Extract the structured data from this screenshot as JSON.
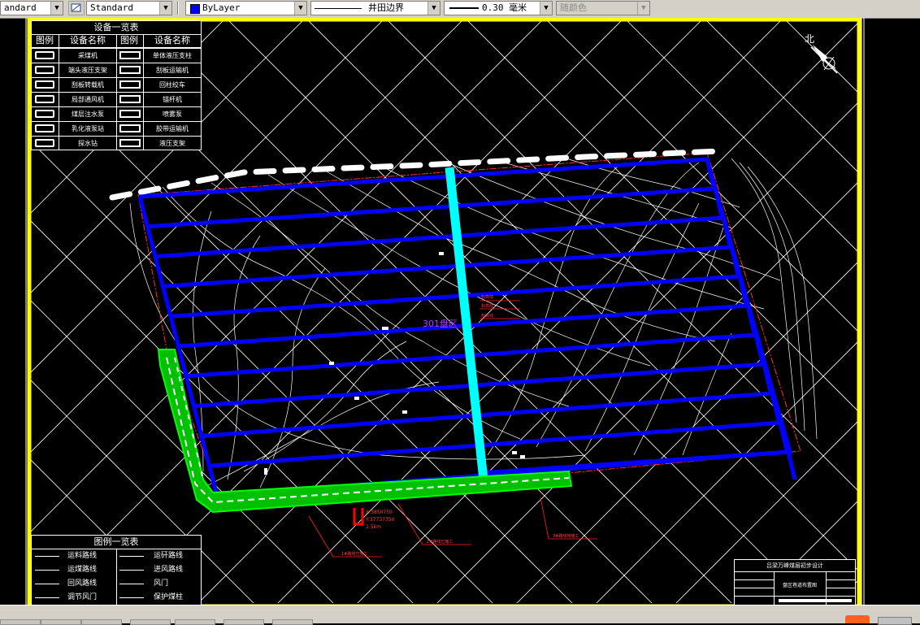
{
  "toolbar": {
    "text_style_value": "andard",
    "dim_style_value": "Standard",
    "layer_color_value": "ByLayer",
    "linetype_value": "井田边界",
    "lineweight_value": "0.30 毫米",
    "plot_style_value": "随颜色",
    "arrow_glyph": "▼"
  },
  "equipment_table": {
    "title": "设备一览表",
    "headers": [
      "图例",
      "设备名称",
      "图例",
      "设备名称"
    ],
    "rows": [
      {
        "left": "采煤机",
        "right": "单体液压支柱"
      },
      {
        "left": "端头液压支架",
        "right": "刮板运输机"
      },
      {
        "left": "刮板转载机",
        "right": "回柱绞车"
      },
      {
        "left": "局部通风机",
        "right": "锚杆机"
      },
      {
        "left": "煤层注水泵",
        "right": "喷雾泵"
      },
      {
        "left": "乳化液泵站",
        "right": "胶带运输机"
      },
      {
        "left": "探水钻",
        "right": "液压支架"
      }
    ]
  },
  "legend_table": {
    "title": "图例一览表",
    "rows": [
      {
        "left": "运料路线",
        "right": "运矸路线"
      },
      {
        "left": "运煤路线",
        "right": "进风路线"
      },
      {
        "left": "回风路线",
        "right": "风门"
      },
      {
        "left": "调节风门",
        "right": "保护煤柱"
      }
    ]
  },
  "drawing": {
    "north_label": "北",
    "district_label": "301盘区",
    "coord_label_1": "X:3850750",
    "coord_label_2": "Y:37737350",
    "coord_label_3": "1:5km"
  },
  "title_block": {
    "title": "吕梁万峰煤层初步设计",
    "subtitle": "盘区巷道布置图"
  },
  "colors": {
    "frame": "#ffff00",
    "roadway": "#0000ff",
    "main_roadway": "#00ffff",
    "pillar": "#00ff00",
    "boundary": "#ff0000"
  }
}
